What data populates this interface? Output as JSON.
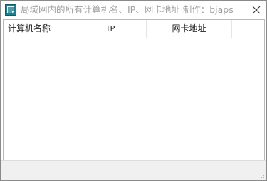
{
  "window": {
    "title": "局域网内的所有计算机名、IP、网卡地址    制作：bjaps"
  },
  "listview": {
    "columns": [
      {
        "label": "计算机名称"
      },
      {
        "label": "IP"
      },
      {
        "label": "网卡地址"
      }
    ],
    "rows": []
  },
  "statusbar": {
    "text": ""
  },
  "colors": {
    "title_text": "#a0a0a0",
    "border": "#8a8a8a",
    "statusbar_bg": "#f0f0f0"
  },
  "icons": {
    "app": "app-icon",
    "close": "close-icon",
    "grip": "resize-grip-icon"
  }
}
